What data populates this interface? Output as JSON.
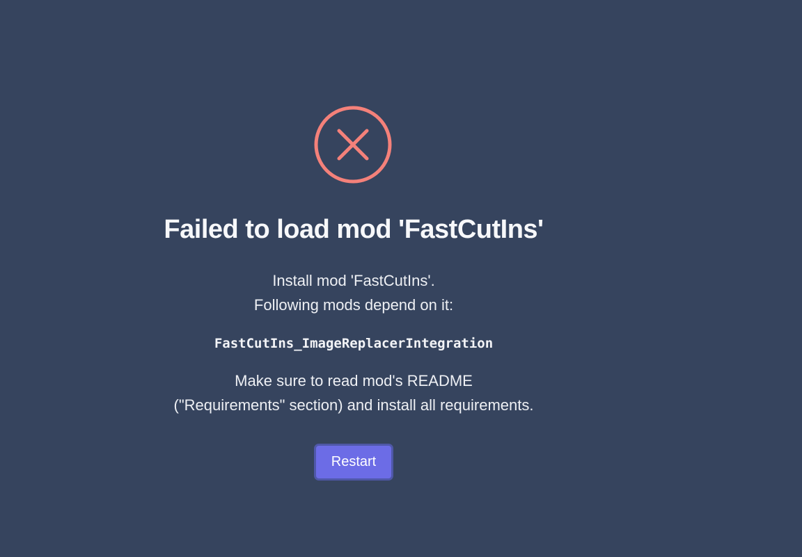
{
  "error": {
    "icon": "close-circle-icon",
    "icon_color": "#f4817a",
    "title": "Failed to load mod 'FastCutIns'",
    "message_line1": "Install mod 'FastCutIns'.",
    "message_line2": "Following mods depend on it:",
    "dependent_mod": "FastCutIns_ImageReplacerIntegration",
    "hint_line1": "Make sure to read mod's README",
    "hint_line2": "(\"Requirements\" section) and install all requirements."
  },
  "actions": {
    "restart_label": "Restart"
  },
  "colors": {
    "background": "#36445e",
    "button": "#6c6ce6",
    "button_border": "#4f58a8"
  }
}
